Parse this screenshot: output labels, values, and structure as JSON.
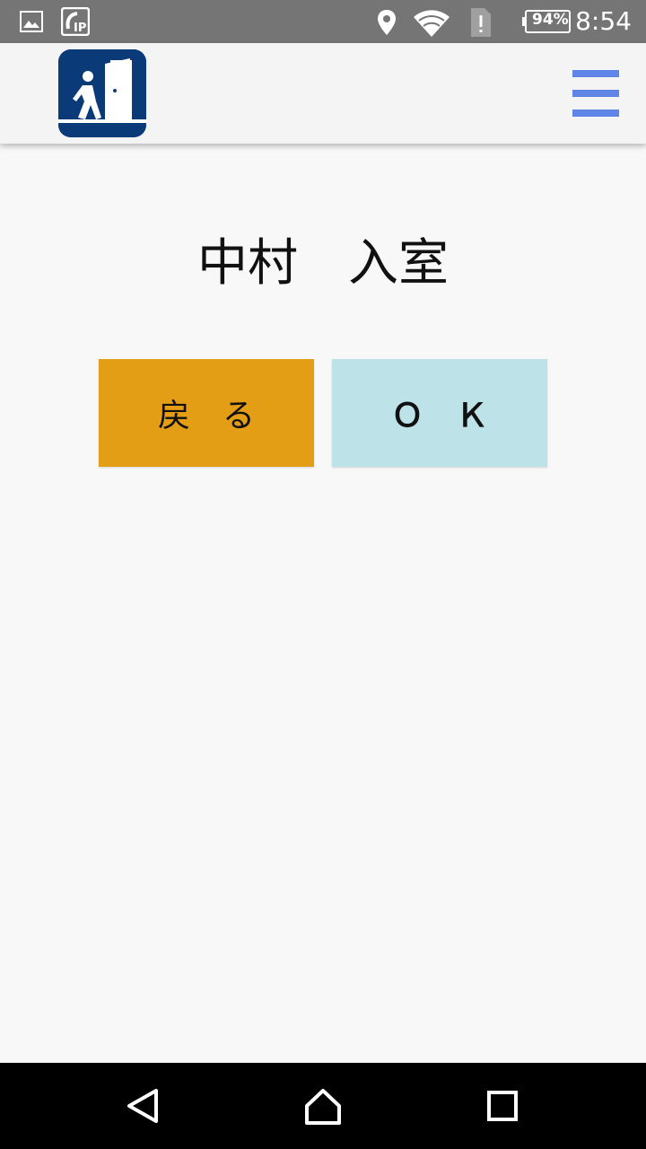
{
  "status_bar": {
    "battery": "94%",
    "time": "8:54",
    "icons": [
      "image-icon",
      "ip-phone-icon",
      "location-icon",
      "wifi-icon",
      "sim-alert-icon",
      "battery-icon"
    ]
  },
  "app_bar": {
    "logo_icon": "exit-door-person-icon",
    "menu_icon": "hamburger-menu-icon",
    "accent_color": "#5f86e6"
  },
  "main": {
    "title": "中村　入室",
    "back_label": "戻　る",
    "ok_label": "Ｏ　Ｋ",
    "back_color": "#e39e15",
    "ok_color": "#bde2e8"
  },
  "nav_bar": {
    "icons": [
      "back-triangle-icon",
      "home-icon",
      "recents-square-icon"
    ]
  }
}
